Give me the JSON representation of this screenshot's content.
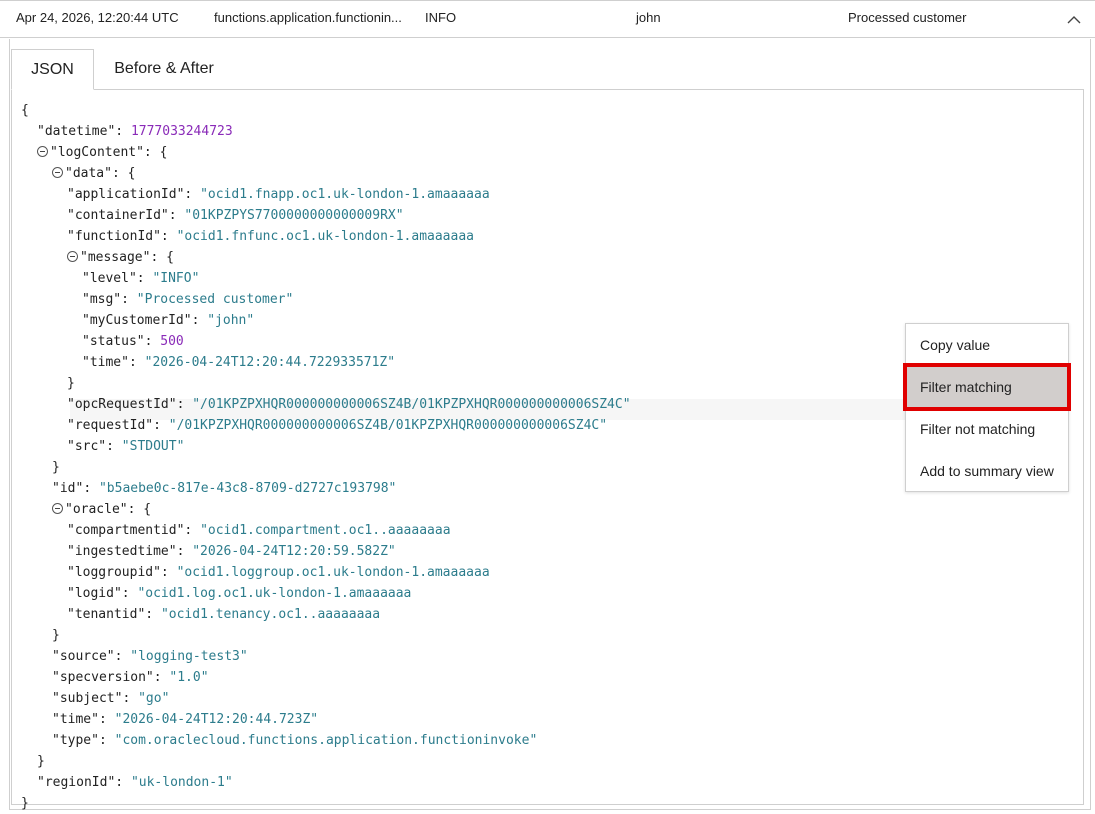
{
  "log_row": {
    "datetime": "Apr 24, 2026, 12:20:44 UTC",
    "type": "functions.application.functioninvoke",
    "type_display": "functions.application.functionin...",
    "level": "INFO",
    "user": "john",
    "message": "Processed customer"
  },
  "tabs": [
    {
      "label": "JSON",
      "active": true
    },
    {
      "label": "Before & After",
      "active": false
    }
  ],
  "json": {
    "open_brace": "{",
    "close_brace": "}",
    "datetime_key": "\"datetime\"",
    "datetime_val": "1777033244723",
    "logContent_key": "\"logContent\"",
    "data_key": "\"data\"",
    "applicationId_key": "\"applicationId\"",
    "applicationId_val": "\"ocid1.fnapp.oc1.uk-london-1.amaaaaaa",
    "containerId_key": "\"containerId\"",
    "containerId_val": "\"01KPZPYS7700000000000009RX\"",
    "functionId_key": "\"functionId\"",
    "functionId_val": "\"ocid1.fnfunc.oc1.uk-london-1.amaaaaaa",
    "message_key": "\"message\"",
    "level_key": "\"level\"",
    "level_val": "\"INFO\"",
    "msg_key": "\"msg\"",
    "msg_val": "\"Processed customer\"",
    "myCustomerId_key": "\"myCustomerId\"",
    "myCustomerId_val": "\"john\"",
    "status_key": "\"status\"",
    "status_val": "500",
    "time_key": "\"time\"",
    "msg_time_val": "\"2026-04-24T12:20:44.722933571Z\"",
    "opcRequestId_key": "\"opcRequestId\"",
    "opcRequestId_val": "\"/01KPZPXHQR000000000006SZ4B/01KPZPXHQR000000000006SZ4C\"",
    "requestId_key": "\"requestId\"",
    "requestId_val": "\"/01KPZPXHQR000000000006SZ4B/01KPZPXHQR000000000006SZ4C\"",
    "src_key": "\"src\"",
    "src_val": "\"STDOUT\"",
    "id_key": "\"id\"",
    "id_val": "\"b5aebe0c-817e-43c8-8709-d2727c193798\"",
    "oracle_key": "\"oracle\"",
    "compartmentid_key": "\"compartmentid\"",
    "compartmentid_val": "\"ocid1.compartment.oc1..aaaaaaaa",
    "ingestedtime_key": "\"ingestedtime\"",
    "ingestedtime_val": "\"2026-04-24T12:20:59.582Z\"",
    "loggroupid_key": "\"loggroupid\"",
    "loggroupid_val": "\"ocid1.loggroup.oc1.uk-london-1.amaaaaaa",
    "logid_key": "\"logid\"",
    "logid_val": "\"ocid1.log.oc1.uk-london-1.amaaaaaa",
    "tenantid_key": "\"tenantid\"",
    "tenantid_val": "\"ocid1.tenancy.oc1..aaaaaaaa",
    "source_key": "\"source\"",
    "source_val": "\"logging-test3\"",
    "specversion_key": "\"specversion\"",
    "specversion_val": "\"1.0\"",
    "subject_key": "\"subject\"",
    "subject_val": "\"go\"",
    "root_time_val": "\"2026-04-24T12:20:44.723Z\"",
    "type_key": "\"type\"",
    "type_val": "\"com.oraclecloud.functions.application.functioninvoke\"",
    "regionId_key": "\"regionId\"",
    "regionId_val": "\"uk-london-1\""
  },
  "context_menu": {
    "items": [
      {
        "label": "Copy value"
      },
      {
        "label": "Filter matching",
        "highlighted": true
      },
      {
        "label": "Filter not matching"
      },
      {
        "label": "Add to summary view"
      }
    ]
  },
  "colors": {
    "string": "#2c7c8c",
    "number": "#8a2bb8",
    "highlight_outline": "#e00000"
  }
}
